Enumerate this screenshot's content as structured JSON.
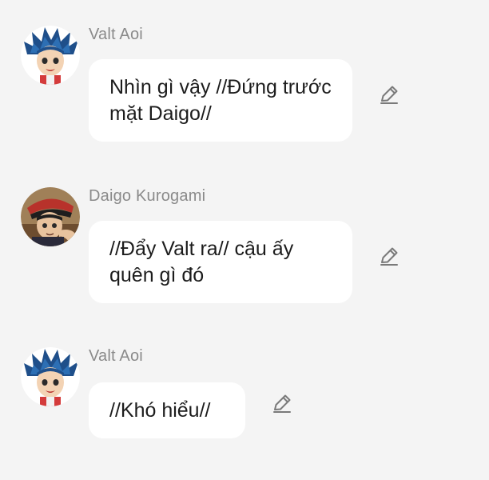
{
  "messages": [
    {
      "author": "Valt Aoi",
      "text": "Nhìn gì vậy //Đứng trước mặt Daigo//",
      "avatar_icon": "valt-aoi-avatar"
    },
    {
      "author": "Daigo Kurogami",
      "text": "//Đẩy Valt ra// cậu ấy quên gì đó",
      "avatar_icon": "daigo-kurogami-avatar"
    },
    {
      "author": "Valt Aoi",
      "text": "//Khó hiểu//",
      "avatar_icon": "valt-aoi-avatar"
    }
  ],
  "edit_icon": "pencil-icon",
  "colors": {
    "background": "#f4f4f4",
    "bubble": "#ffffff",
    "name": "#8a8a8a",
    "text": "#1c1c1c",
    "icon": "#7a7a7a"
  }
}
